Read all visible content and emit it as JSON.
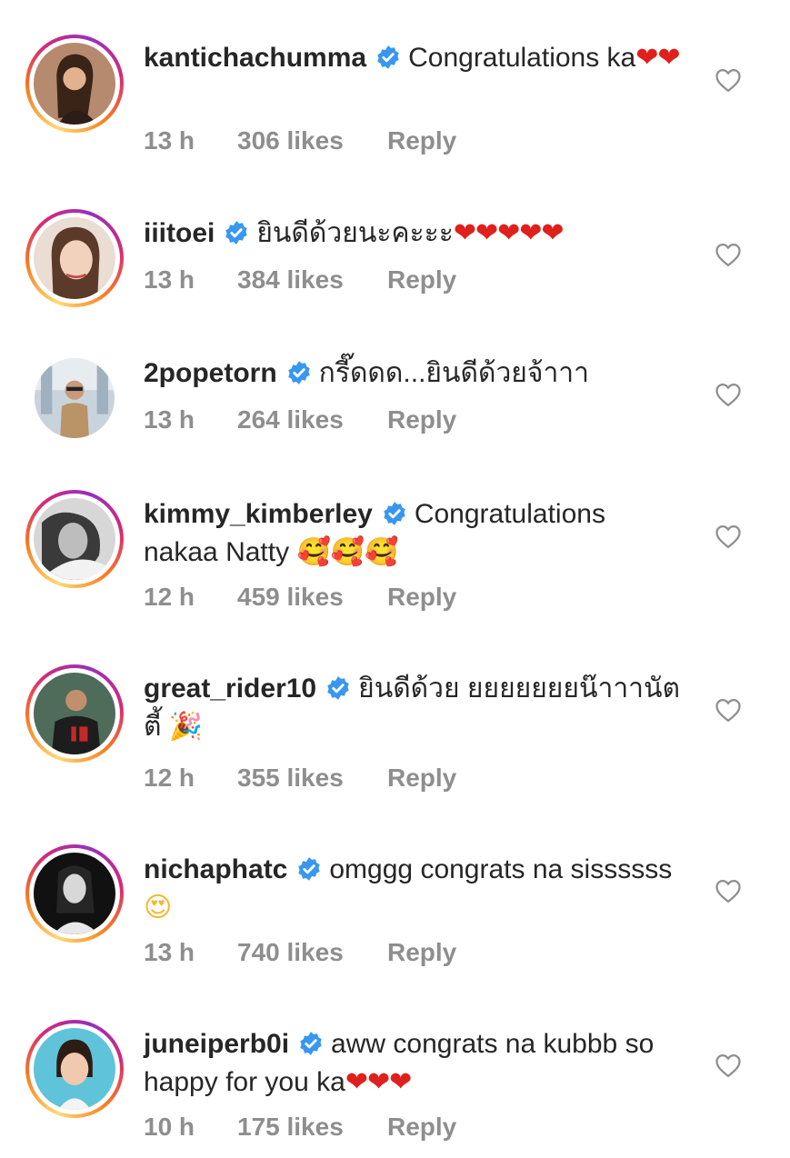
{
  "comments": [
    {
      "username": "kantichachumma",
      "text": "Congratulations ka",
      "emoji": "❤❤",
      "time": "13 h",
      "likes": "306 likes",
      "reply": "Reply",
      "avatar_ring": true
    },
    {
      "username": "iiitoei",
      "text": "ยินดีด้วยนะคะะะ",
      "emoji": "❤❤❤❤❤",
      "time": "13 h",
      "likes": "384 likes",
      "reply": "Reply",
      "avatar_ring": true
    },
    {
      "username": "2popetorn",
      "text": "กรี๊ดดด...ยินดีด้วยจ้าาา",
      "emoji": "",
      "time": "13 h",
      "likes": "264 likes",
      "reply": "Reply",
      "avatar_ring": false
    },
    {
      "username": "kimmy_kimberley",
      "text": "Congratulations nakaa Natty",
      "emoji": "🥰🥰🥰",
      "time": "12 h",
      "likes": "459 likes",
      "reply": "Reply",
      "avatar_ring": true
    },
    {
      "username": "great_rider10",
      "text": "ยินดีด้วย ยยยยยยยน๊าาานัตตี้",
      "emoji": "🎉",
      "time": "12 h",
      "likes": "355 likes",
      "reply": "Reply",
      "avatar_ring": true
    },
    {
      "username": "nichaphatc",
      "text": "omggg congrats na sissssss",
      "emoji": "😍",
      "time": "13 h",
      "likes": "740 likes",
      "reply": "Reply",
      "avatar_ring": true
    },
    {
      "username": "juneiperb0i",
      "text": "aww congrats na kubbb so happy for you ka",
      "emoji": "❤❤❤",
      "time": "10 h",
      "likes": "175 likes",
      "reply": "Reply",
      "avatar_ring": true
    }
  ],
  "icons": {
    "verified": "verified-badge-icon",
    "like": "heart-outline-icon"
  },
  "colors": {
    "verified_blue": "#3897f0",
    "muted": "#8e8e8e",
    "text": "#262626",
    "heart_red": "#e0201c"
  }
}
